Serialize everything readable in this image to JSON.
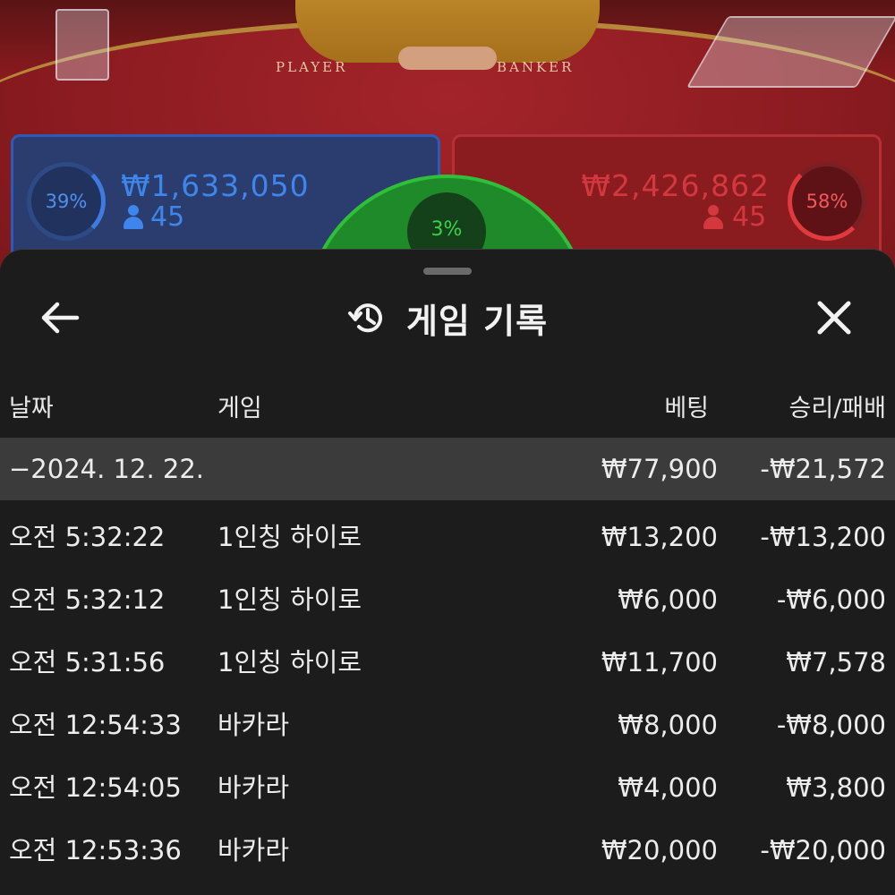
{
  "game_view": {
    "labels": {
      "player": "PLAYER",
      "banker": "BANKER"
    },
    "player": {
      "percent": "39%",
      "amount": "₩1,633,050",
      "count": "45"
    },
    "banker": {
      "percent": "58%",
      "amount": "₩2,426,862",
      "count": "45"
    },
    "tie": {
      "percent": "3%"
    },
    "colors": {
      "player": "#3f86ec",
      "banker": "#d2383d",
      "tie": "#39d24a"
    }
  },
  "sheet": {
    "title": "게임 기록",
    "icons": {
      "back": "arrow-left-icon",
      "history": "history-icon",
      "close": "close-icon"
    },
    "columns": {
      "date": "날짜",
      "game": "게임",
      "bet": "베팅",
      "result": "승리/패배"
    },
    "summary": {
      "date": "−2024. 12. 22.",
      "bet": "₩77,900",
      "result": "-₩21,572"
    },
    "rows": [
      {
        "time": "오전 5:32:22",
        "game": "1인칭 하이로",
        "bet": "₩13,200",
        "result": "-₩13,200"
      },
      {
        "time": "오전 5:32:12",
        "game": "1인칭 하이로",
        "bet": "₩6,000",
        "result": "-₩6,000"
      },
      {
        "time": "오전 5:31:56",
        "game": "1인칭 하이로",
        "bet": "₩11,700",
        "result": "₩7,578"
      },
      {
        "time": "오전 12:54:33",
        "game": "바카라",
        "bet": "₩8,000",
        "result": "-₩8,000"
      },
      {
        "time": "오전 12:54:05",
        "game": "바카라",
        "bet": "₩4,000",
        "result": "₩3,800"
      },
      {
        "time": "오전 12:53:36",
        "game": "바카라",
        "bet": "₩20,000",
        "result": "-₩20,000"
      }
    ]
  }
}
